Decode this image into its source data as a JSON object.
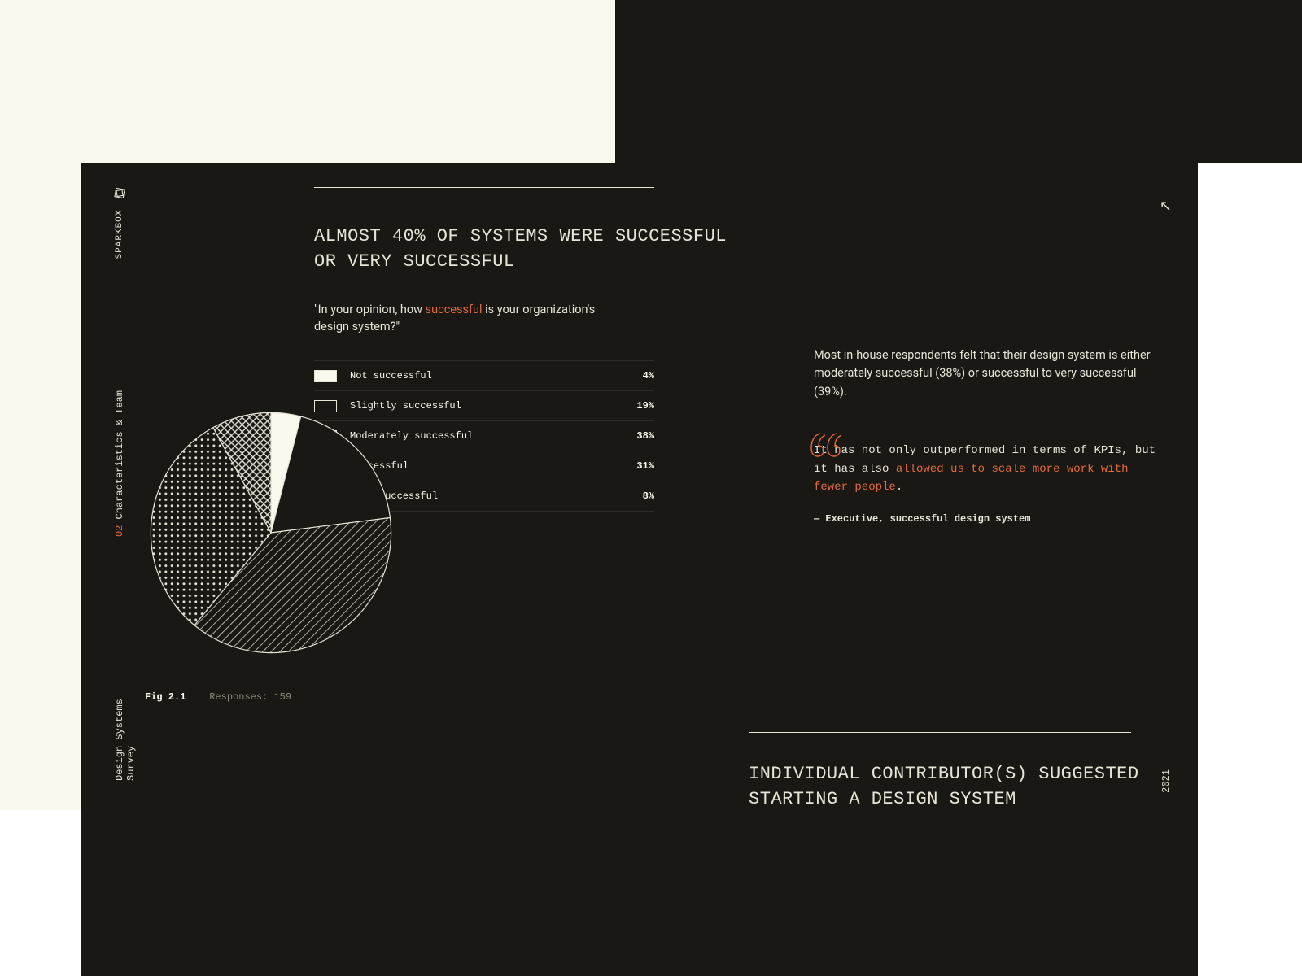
{
  "brand": "SPARKBOX",
  "section": {
    "num": "02",
    "name": "Characteristics & Team"
  },
  "survey_title": "Design Systems Survey",
  "year": "2021",
  "colors": {
    "accent": "#e46a3a",
    "bg_dark": "#1a1815",
    "cream": "#fbf8ee"
  },
  "chart_data": {
    "type": "pie",
    "title": "ALMOST 40% OF SYSTEMS WERE SUCCESSFUL OR VERY SUCCESSFUL",
    "question_pre": "\"In your opinion, how ",
    "question_accent": "successful",
    "question_post": " is your organization's design system?\"",
    "categories": [
      "Not successful",
      "Slightly successful",
      "Moderately successful",
      "Successful",
      "Very successful"
    ],
    "values": [
      4,
      19,
      38,
      31,
      8
    ],
    "units": "%",
    "fig_label": "Fig 2.1",
    "responses_label": "Responses: 159",
    "responses": 159,
    "legend_position": "right-of-chart",
    "palette_note": "monochrome hatch patterns (solid / outline / diagonal / dots / crosshatch)"
  },
  "narrative": "Most in-house respondents felt that their design system is either moderately successful (38%) or successful to very successful (39%).",
  "quote": {
    "pre": "It has not only outperformed in terms of KPIs, but it has also ",
    "accent": "allowed us to scale more work with fewer people",
    "post": ".",
    "attribution_prefix": "— ",
    "attribution": "Executive, successful design system"
  },
  "next_heading": "INDIVIDUAL CONTRIBUTOR(S) SUGGESTED STARTING A DESIGN SYSTEM",
  "icons": {
    "top_arrow": "↖"
  }
}
